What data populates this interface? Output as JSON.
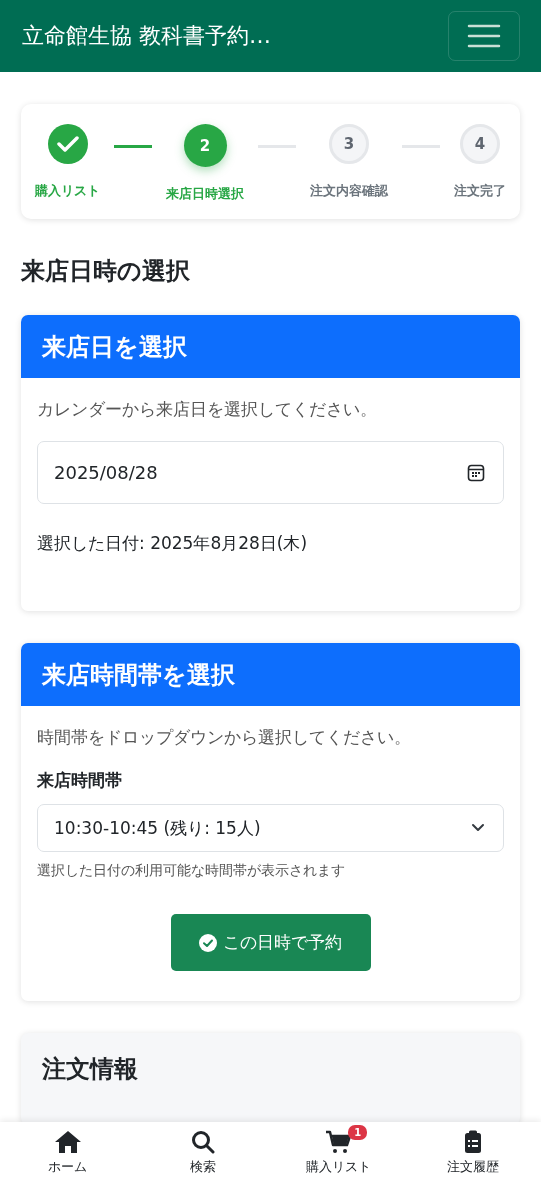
{
  "header": {
    "title": "立命館生協 教科書予約…"
  },
  "steps": [
    {
      "kind": "done",
      "label": "購入リスト"
    },
    {
      "kind": "current",
      "number": "2",
      "label": "来店日時選択"
    },
    {
      "kind": "pending",
      "number": "3",
      "label": "注文内容確認"
    },
    {
      "kind": "pending",
      "number": "4",
      "label": "注文完了"
    }
  ],
  "page_title": "来店日時の選択",
  "date_card": {
    "title": "来店日を選択",
    "instruction": "カレンダーから来店日を選択してください。",
    "date_value": "2025/08/28",
    "selected_text": "選択した日付: 2025年8月28日(木)"
  },
  "time_card": {
    "title": "来店時間帯を選択",
    "instruction": "時間帯をドロップダウンから選択してください。",
    "field_label": "来店時間帯",
    "select_value": "10:30-10:45 (残り: 15人)",
    "help": "選択した日付の利用可能な時間帯が表示されます",
    "button": "この日時で予約"
  },
  "order_card": {
    "title": "注文情報"
  },
  "bottom_nav": [
    {
      "label": "ホーム"
    },
    {
      "label": "検索"
    },
    {
      "label": "購入リスト",
      "badge": "1"
    },
    {
      "label": "注文履歴"
    }
  ]
}
